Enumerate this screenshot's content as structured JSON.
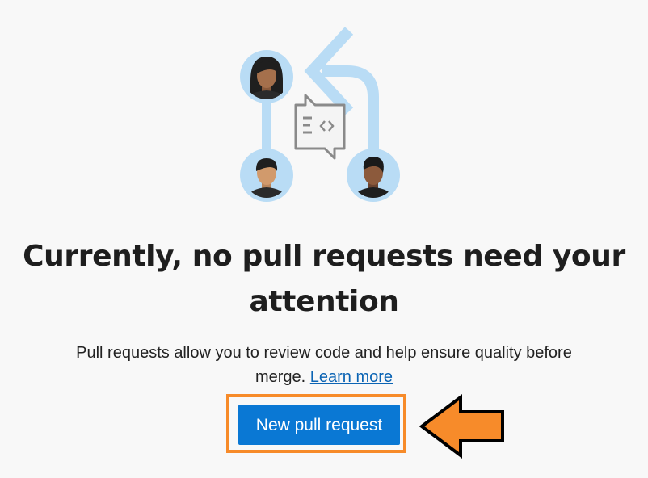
{
  "empty_state": {
    "title_line1": "Currently, no pull requests need your",
    "title_line2": "attention",
    "description_line1": "Pull requests allow you to review code and help ensure quality before",
    "description_line2": "merge.",
    "learn_more_label": "Learn more",
    "illustration_icons": [
      "person-avatar-icon",
      "person-avatar-icon",
      "person-avatar-icon",
      "code-review-chat-icon",
      "return-arrow-icon"
    ]
  },
  "actions": {
    "new_pull_request_label": "New pull request"
  },
  "annotation": {
    "highlight_color": "#f78b2a",
    "arrow_icon": "pointing-left-arrow-icon"
  },
  "colors": {
    "button_bg": "#0a78d4",
    "link": "#0b64b4",
    "illustration_light_blue": "#b9dcf5"
  }
}
